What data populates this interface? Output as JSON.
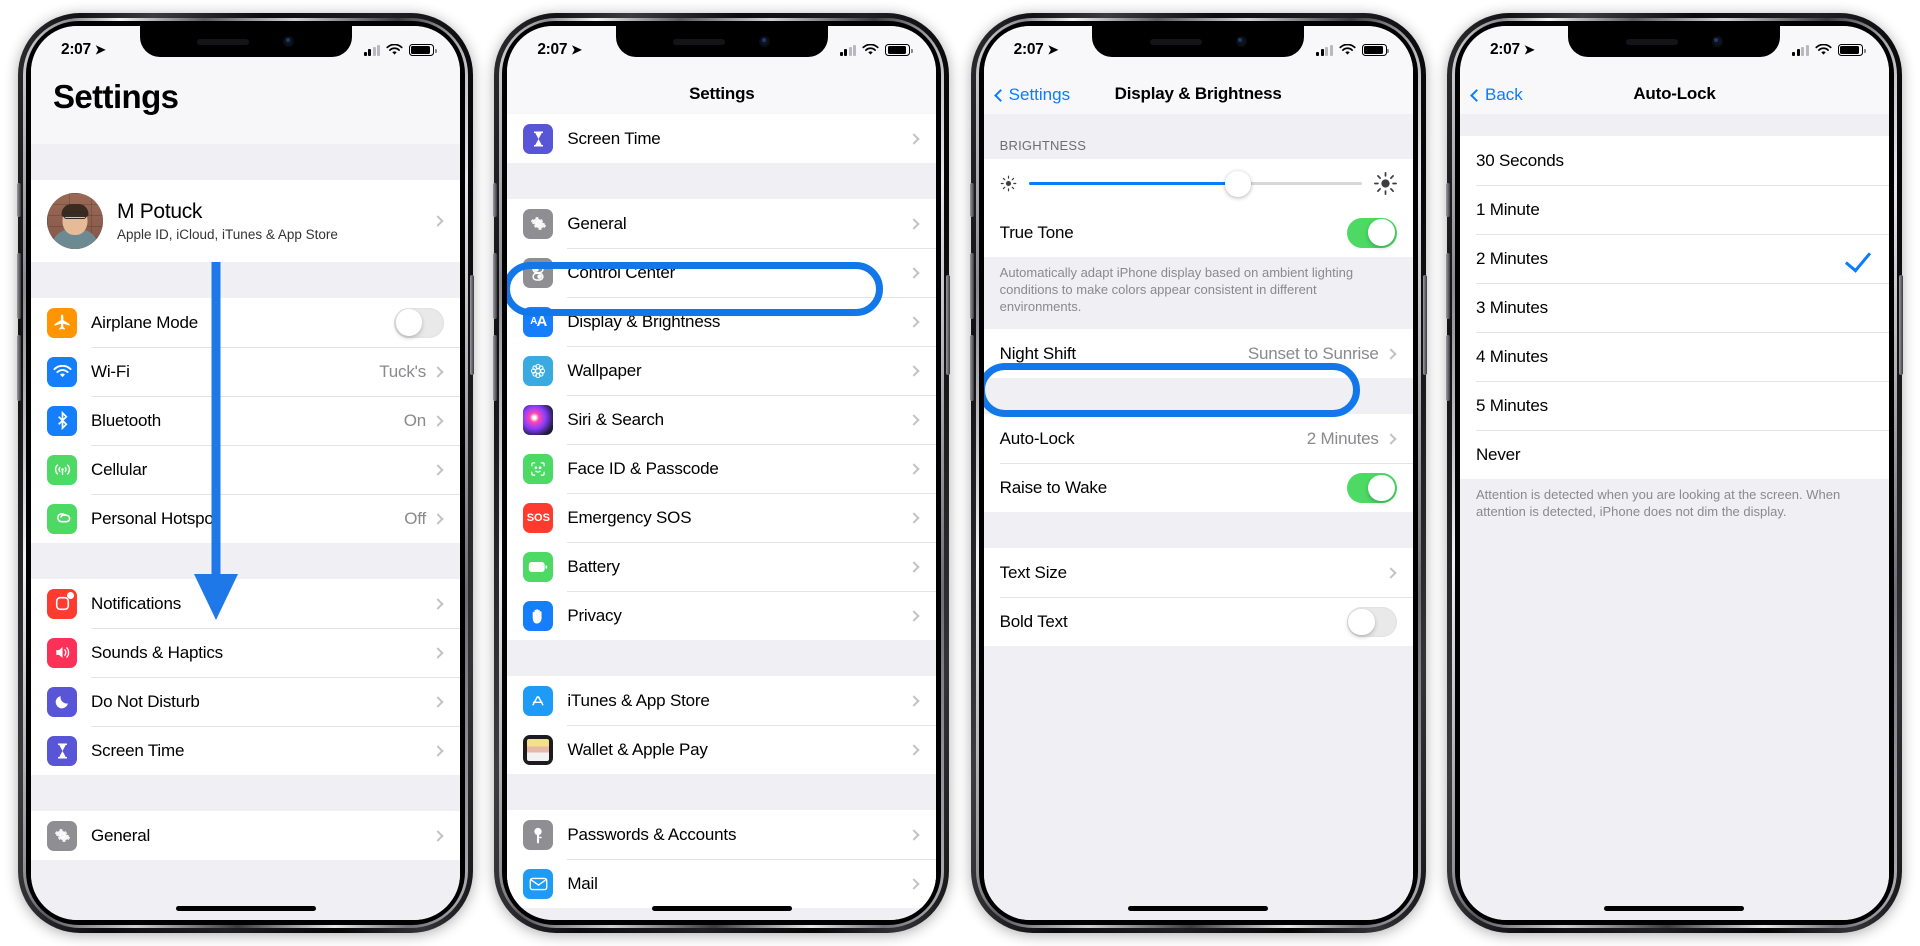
{
  "status_bar": {
    "time": "2:07",
    "location_icon": "location-arrow-icon",
    "signal_icon": "cellular-signal-icon",
    "wifi_icon": "wifi-icon",
    "battery_icon": "battery-icon"
  },
  "screen1": {
    "name": "settings-main-screen",
    "title": "Settings",
    "account": {
      "name": "M Potuck",
      "subtitle": "Apple ID, iCloud, iTunes & App Store",
      "avatar": "user-avatar"
    },
    "group_connectivity": [
      {
        "label": "Airplane Mode",
        "icon": "airplane-icon",
        "icon_color": "#ff9500",
        "control": "toggle",
        "toggle_on": false
      },
      {
        "label": "Wi-Fi",
        "icon": "wifi-icon",
        "icon_color": "#147efb",
        "value": "Tuck's",
        "control": "chevron"
      },
      {
        "label": "Bluetooth",
        "icon": "bluetooth-icon",
        "icon_color": "#147efb",
        "value": "On",
        "control": "chevron"
      },
      {
        "label": "Cellular",
        "icon": "cellular-icon",
        "icon_color": "#4cd964",
        "value": "",
        "control": "chevron"
      },
      {
        "label": "Personal Hotspot",
        "icon": "hotspot-icon",
        "icon_color": "#4cd964",
        "value": "Off",
        "control": "chevron"
      }
    ],
    "group_alerts": [
      {
        "label": "Notifications",
        "icon": "notifications-icon",
        "icon_color": "#ff3b30",
        "control": "chevron"
      },
      {
        "label": "Sounds & Haptics",
        "icon": "sounds-icon",
        "icon_color": "#fc3158",
        "control": "chevron"
      },
      {
        "label": "Do Not Disturb",
        "icon": "moon-icon",
        "icon_color": "#5856d6",
        "control": "chevron"
      },
      {
        "label": "Screen Time",
        "icon": "hourglass-icon",
        "icon_color": "#5856d6",
        "control": "chevron"
      }
    ],
    "group_system": [
      {
        "label": "General",
        "icon": "gear-icon",
        "icon_color": "#8e8e93",
        "control": "chevron"
      }
    ]
  },
  "screen2": {
    "name": "settings-scrolled-screen",
    "title": "Settings",
    "group_top": [
      {
        "label": "Screen Time",
        "icon": "hourglass-icon",
        "icon_color": "#5856d6",
        "control": "chevron"
      }
    ],
    "group_main": [
      {
        "label": "General",
        "icon": "gear-icon",
        "icon_color": "#8e8e93",
        "control": "chevron",
        "highlight": false
      },
      {
        "label": "Control Center",
        "icon": "control-center-icon",
        "icon_color": "#8e8e93",
        "control": "chevron",
        "highlight": false
      },
      {
        "label": "Display & Brightness",
        "icon": "display-brightness-icon",
        "icon_color": "#147efb",
        "control": "chevron",
        "highlight": true
      },
      {
        "label": "Wallpaper",
        "icon": "wallpaper-icon",
        "icon_color": "#3aabe0",
        "control": "chevron",
        "highlight": false
      },
      {
        "label": "Siri & Search",
        "icon": "siri-icon",
        "icon_color": "#1c1c2e",
        "control": "chevron",
        "highlight": false
      },
      {
        "label": "Face ID & Passcode",
        "icon": "face-id-icon",
        "icon_color": "#4cd964",
        "control": "chevron",
        "highlight": false
      },
      {
        "label": "Emergency SOS",
        "icon": "emergency-sos-icon",
        "icon_color": "#ff3b30",
        "control": "chevron",
        "highlight": false
      },
      {
        "label": "Battery",
        "icon": "battery-icon",
        "icon_color": "#4cd964",
        "control": "chevron",
        "highlight": false
      },
      {
        "label": "Privacy",
        "icon": "privacy-hand-icon",
        "icon_color": "#147efb",
        "control": "chevron",
        "highlight": false
      }
    ],
    "group_stores": [
      {
        "label": "iTunes & App Store",
        "icon": "app-store-icon",
        "icon_color": "#1d9bf6",
        "control": "chevron"
      },
      {
        "label": "Wallet & Apple Pay",
        "icon": "wallet-icon",
        "icon_color": "#1c1c1e",
        "control": "chevron"
      }
    ],
    "group_accounts": [
      {
        "label": "Passwords & Accounts",
        "icon": "passwords-key-icon",
        "icon_color": "#8e8e93",
        "control": "chevron"
      },
      {
        "label": "Mail",
        "icon": "mail-icon",
        "icon_color": "#1d9bf6",
        "control": "chevron"
      }
    ]
  },
  "screen3": {
    "name": "display-brightness-screen",
    "back_label": "Settings",
    "title": "Display & Brightness",
    "brightness_header": "BRIGHTNESS",
    "brightness_value_percent": 63,
    "brightness_low_icon": "brightness-low-icon",
    "brightness_high_icon": "brightness-high-icon",
    "true_tone": {
      "label": "True Tone",
      "toggle_on": true
    },
    "true_tone_footer": "Automatically adapt iPhone display based on ambient lighting conditions to make colors appear consistent in different environments.",
    "night_shift": {
      "label": "Night Shift",
      "value": "Sunset to Sunrise"
    },
    "auto_lock": {
      "label": "Auto-Lock",
      "value": "2 Minutes",
      "highlight": true
    },
    "raise_to_wake": {
      "label": "Raise to Wake",
      "toggle_on": true
    },
    "text_size": {
      "label": "Text Size"
    },
    "bold_text": {
      "label": "Bold Text",
      "toggle_on": false
    }
  },
  "screen4": {
    "name": "auto-lock-screen",
    "back_label": "Back",
    "title": "Auto-Lock",
    "options": [
      {
        "label": "30 Seconds",
        "selected": false
      },
      {
        "label": "1 Minute",
        "selected": false
      },
      {
        "label": "2 Minutes",
        "selected": true
      },
      {
        "label": "3 Minutes",
        "selected": false
      },
      {
        "label": "4 Minutes",
        "selected": false
      },
      {
        "label": "5 Minutes",
        "selected": false
      },
      {
        "label": "Never",
        "selected": false
      }
    ],
    "footer": "Attention is detected when you are looking at the screen. When attention is detected, iPhone does not dim the display."
  },
  "annotations": {
    "arrow_color": "#1f78e8",
    "highlight_color": "#1277e8",
    "arrow_name": "scroll-down-arrow-annotation",
    "oval_display_brightness": "display-brightness-highlight-annotation",
    "oval_auto_lock": "auto-lock-highlight-annotation"
  }
}
